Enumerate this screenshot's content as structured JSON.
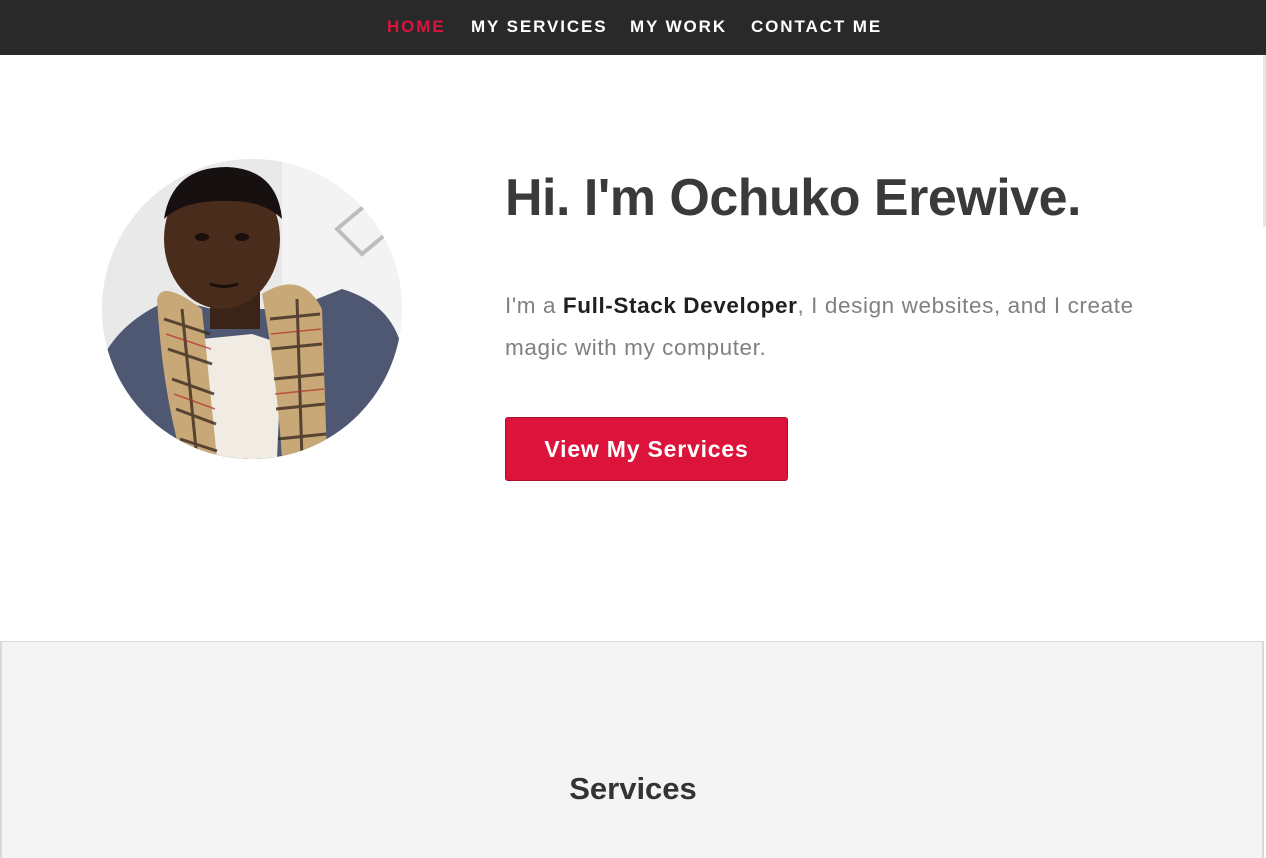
{
  "nav": {
    "items": [
      {
        "label": "HOME",
        "active": true
      },
      {
        "label": "MY SERVICES",
        "active": false
      },
      {
        "label": "MY WORK",
        "active": false
      },
      {
        "label": "CONTACT ME",
        "active": false
      }
    ]
  },
  "hero": {
    "greeting_prefix": "Hi. I'm ",
    "name": "Ochuko Erewive.",
    "intro_prefix": "I'm a ",
    "intro_role": "Full-Stack Developer",
    "intro_suffix": ", I design websites, and I create magic with my computer.",
    "cta_label": "View My Services",
    "avatar_icon": "profile-photo"
  },
  "services": {
    "title": "Services"
  },
  "colors": {
    "accent": "#dc143c",
    "nav_background": "#292929",
    "text_dark": "#3a3a3a",
    "text_muted": "#808080",
    "section_background": "#f4f4f4"
  }
}
